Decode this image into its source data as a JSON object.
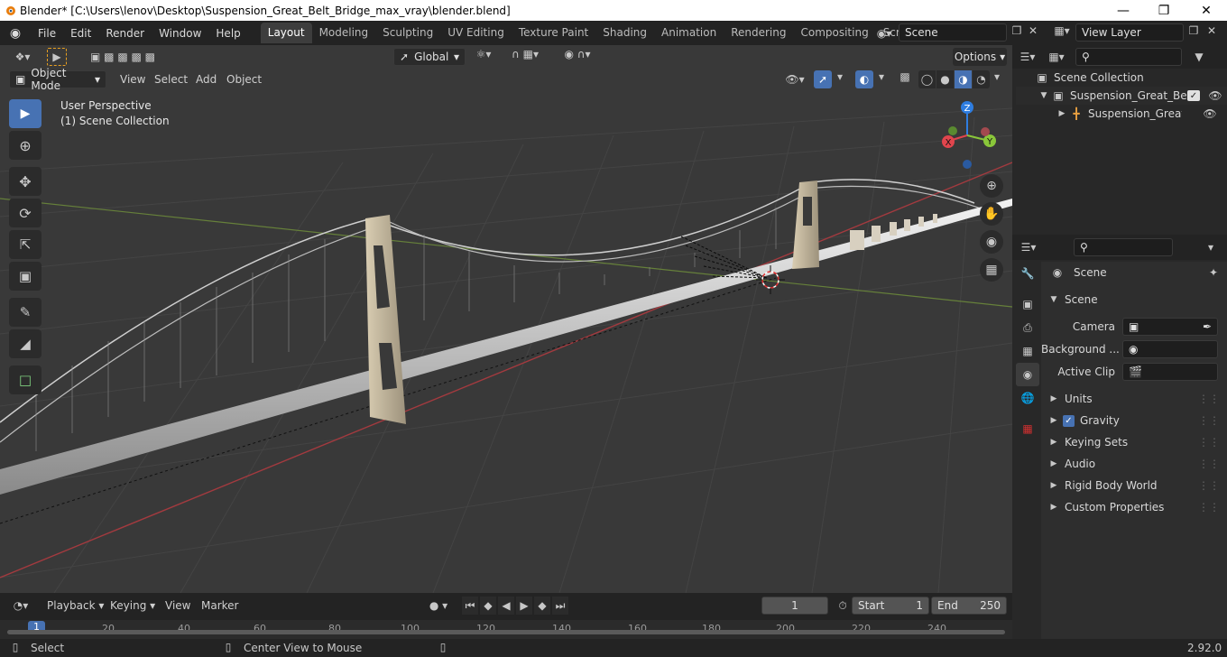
{
  "window": {
    "title": "Blender* [C:\\Users\\lenov\\Desktop\\Suspension_Great_Belt_Bridge_max_vray\\blender.blend]"
  },
  "menu": [
    "File",
    "Edit",
    "Render",
    "Window",
    "Help"
  ],
  "workspaces": [
    "Layout",
    "Modeling",
    "Sculpting",
    "UV Editing",
    "Texture Paint",
    "Shading",
    "Animation",
    "Rendering",
    "Compositing",
    "Scripting"
  ],
  "scene_field": "Scene",
  "viewlayer_field": "View Layer",
  "viewport": {
    "transform_orientation": "Global",
    "options_label": "Options",
    "mode": "Object Mode",
    "header_menus": [
      "View",
      "Select",
      "Add",
      "Object"
    ],
    "overlay_line1": "User Perspective",
    "overlay_line2": "(1) Scene Collection",
    "gizmo": {
      "x": "X",
      "y": "Y",
      "z": "Z"
    }
  },
  "outliner": {
    "root": "Scene Collection",
    "collection": "Suspension_Great_Belt_E",
    "object": "Suspension_Great_Bı"
  },
  "properties": {
    "context": "Scene",
    "panel": "Scene",
    "fields": [
      {
        "label": "Camera"
      },
      {
        "label": "Background ..."
      },
      {
        "label": "Active Clip"
      }
    ],
    "subpanels": [
      "Units",
      "Gravity",
      "Keying Sets",
      "Audio",
      "Rigid Body World",
      "Custom Properties"
    ]
  },
  "timeline": {
    "menus": [
      "Playback",
      "Keying",
      "View",
      "Marker"
    ],
    "current_frame": "1",
    "start_label": "Start",
    "start": "1",
    "end_label": "End",
    "end": "250",
    "ticks": [
      "1",
      "20",
      "40",
      "60",
      "80",
      "100",
      "120",
      "140",
      "160",
      "180",
      "200",
      "220",
      "240"
    ]
  },
  "status": {
    "left": "Select",
    "middle": "Center View to Mouse",
    "version": "2.92.0"
  },
  "colors": {
    "accent": "#4772b3",
    "axis_x": "#e0454d",
    "axis_y": "#8ac73a",
    "axis_z": "#2e7de0"
  }
}
